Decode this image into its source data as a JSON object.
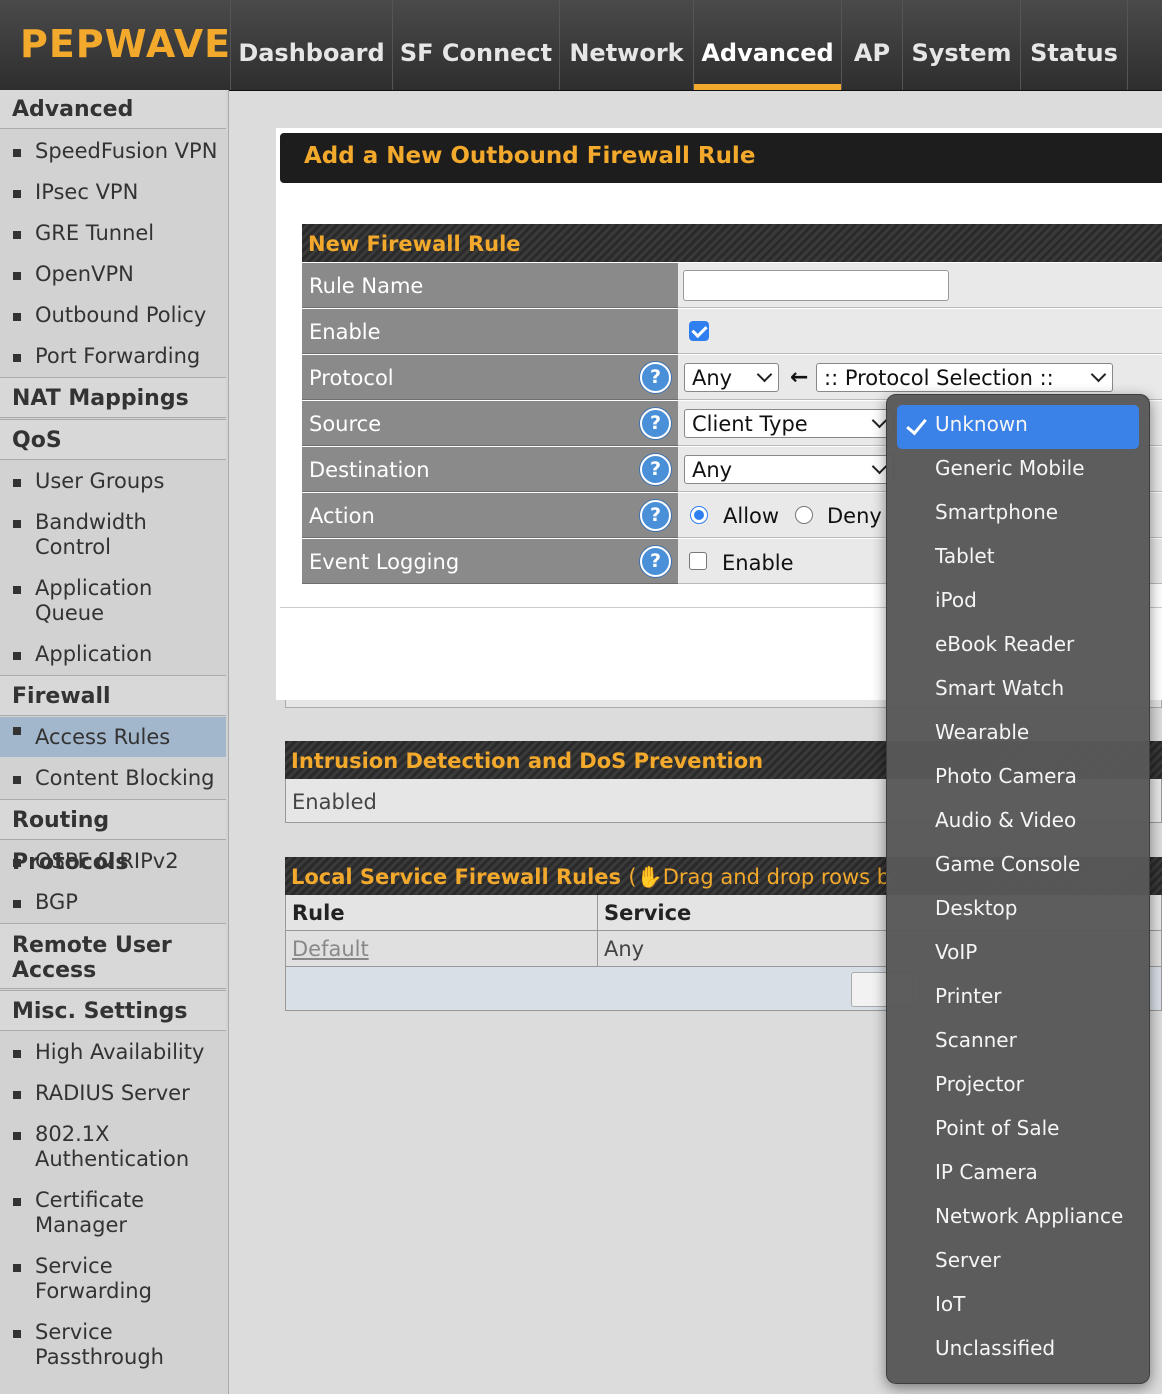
{
  "brand": {
    "logo": "PEPWAVE",
    "accent": "#f2a92c"
  },
  "nav": {
    "tabs": [
      {
        "label": "Dashboard"
      },
      {
        "label": "SF Connect"
      },
      {
        "label": "Network"
      },
      {
        "label": "Advanced"
      },
      {
        "label": "AP"
      },
      {
        "label": "System"
      },
      {
        "label": "Status"
      }
    ],
    "active": "Advanced"
  },
  "sidebar": {
    "advanced": "Advanced",
    "advanced_items": [
      "SpeedFusion VPN",
      "IPsec VPN",
      "GRE Tunnel",
      "OpenVPN",
      "Outbound Policy",
      "Port Forwarding"
    ],
    "nat": "NAT Mappings",
    "qos": "QoS",
    "qos_items": [
      "User Groups",
      "Bandwidth Control",
      "Application Queue",
      "Application"
    ],
    "firewall": "Firewall",
    "firewall_items": [
      "Access Rules",
      "Content Blocking"
    ],
    "routing": "Routing Protocols",
    "routing_items": [
      "OSPF & RIPv2",
      "BGP"
    ],
    "remote": "Remote User Access",
    "misc": "Misc. Settings",
    "misc_items": [
      "High Availability",
      "RADIUS Server",
      "802.1X Authentication",
      "Certificate Manager",
      "Service Forwarding",
      "Service Passthrough"
    ]
  },
  "page": {
    "title": "Add a New Outbound Firewall Rule",
    "section": "New Firewall Rule",
    "rows": {
      "rule_name": "Rule Name",
      "enable": "Enable",
      "protocol": "Protocol",
      "source": "Source",
      "destination": "Destination",
      "action": "Action",
      "event_logging": "Event Logging"
    },
    "protocol_value": "Any",
    "protocol_selection": ":: Protocol Selection ::",
    "source_value": "Client Type",
    "destination_value": "Any",
    "action_allow": "Allow",
    "action_deny": "Deny",
    "logging_label": "Enable",
    "help_glyph": "?"
  },
  "intrusion": {
    "title": "Intrusion Detection and DoS Prevention",
    "status": "Enabled"
  },
  "local_service": {
    "title": "Local Service Firewall Rules",
    "hint": "Drag and drop rows b",
    "col_rule": "Rule",
    "col_service": "Service",
    "default_rule": "Default",
    "default_service": "Any"
  },
  "dropdown": {
    "selected": "Unknown",
    "options": [
      "Unknown",
      "Generic Mobile",
      "Smartphone",
      "Tablet",
      "iPod",
      "eBook Reader",
      "Smart Watch",
      "Wearable",
      "Photo Camera",
      "Audio & Video",
      "Game Console",
      "Desktop",
      "VoIP",
      "Printer",
      "Scanner",
      "Projector",
      "Point of Sale",
      "IP Camera",
      "Network Appliance",
      "Server",
      "IoT",
      "Unclassified"
    ]
  }
}
